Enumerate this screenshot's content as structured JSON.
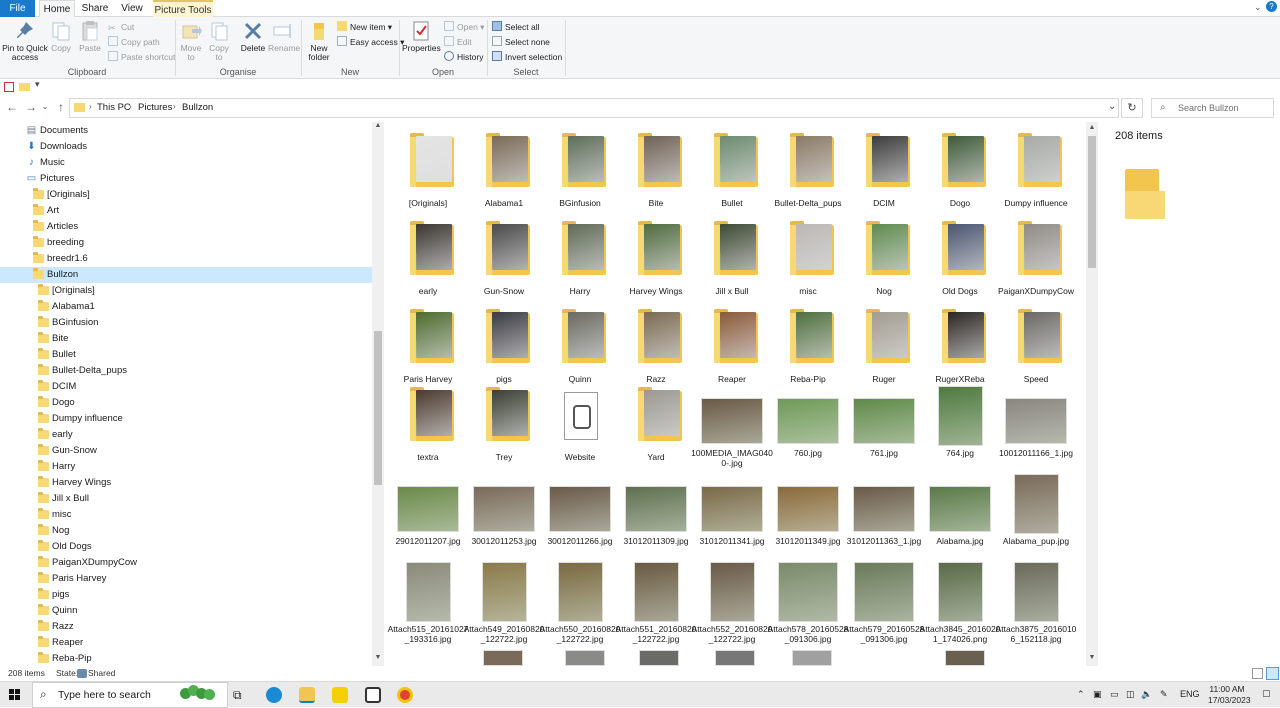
{
  "ribbon_tabs": [
    "File",
    "Home",
    "Share",
    "View",
    "Picture Tools"
  ],
  "ribbon": {
    "clipboard": {
      "pin_label": "Pin to Quick access",
      "copy_label": "Copy",
      "paste_label": "Paste",
      "cut_label": "Cut",
      "copy_path_label": "Copy path",
      "paste_shortcut_label": "Paste shortcut",
      "group_label": "Clipboard"
    },
    "organise": {
      "move_to_label": "Move to",
      "copy_to_label": "Copy to",
      "delete_label": "Delete",
      "rename_label": "Rename",
      "group_label": "Organise"
    },
    "new": {
      "new_folder_label": "New folder",
      "new_item_label": "New item",
      "easy_access_label": "Easy access",
      "group_label": "New"
    },
    "open": {
      "properties_label": "Properties",
      "open_label": "Open",
      "edit_label": "Edit",
      "history_label": "History",
      "group_label": "Open"
    },
    "select": {
      "select_all_label": "Select all",
      "select_none_label": "Select none",
      "invert_label": "Invert selection",
      "group_label": "Select"
    }
  },
  "breadcrumb": [
    "This PC",
    "Pictures",
    "Bullzon"
  ],
  "search_placeholder": "Search Bullzon",
  "nav_tree": [
    {
      "label": "Documents",
      "icon": "documents-icon",
      "level": 0
    },
    {
      "label": "Downloads",
      "icon": "downloads-icon",
      "level": 0
    },
    {
      "label": "Music",
      "icon": "music-icon",
      "level": 0
    },
    {
      "label": "Pictures",
      "icon": "pictures-icon",
      "level": 0
    },
    {
      "label": "[Originals]",
      "icon": "folder-icon",
      "level": 1
    },
    {
      "label": "Art",
      "icon": "folder-icon",
      "level": 1
    },
    {
      "label": "Articles",
      "icon": "folder-icon",
      "level": 1
    },
    {
      "label": "breeding",
      "icon": "folder-icon",
      "level": 1
    },
    {
      "label": "breedr1.6",
      "icon": "folder-icon",
      "level": 1
    },
    {
      "label": "Bullzon",
      "icon": "folder-icon",
      "level": 1,
      "selected": true
    },
    {
      "label": "[Originals]",
      "icon": "folder-icon",
      "level": 2
    },
    {
      "label": "Alabama1",
      "icon": "folder-icon",
      "level": 2
    },
    {
      "label": "BGinfusion",
      "icon": "folder-icon",
      "level": 2
    },
    {
      "label": "Bite",
      "icon": "folder-icon",
      "level": 2
    },
    {
      "label": "Bullet",
      "icon": "folder-icon",
      "level": 2
    },
    {
      "label": "Bullet-Delta_pups",
      "icon": "folder-icon",
      "level": 2
    },
    {
      "label": "DCIM",
      "icon": "folder-icon",
      "level": 2
    },
    {
      "label": "Dogo",
      "icon": "folder-icon",
      "level": 2
    },
    {
      "label": "Dumpy influence",
      "icon": "folder-icon",
      "level": 2
    },
    {
      "label": "early",
      "icon": "folder-icon",
      "level": 2
    },
    {
      "label": "Gun-Snow",
      "icon": "folder-icon",
      "level": 2
    },
    {
      "label": "Harry",
      "icon": "folder-icon",
      "level": 2
    },
    {
      "label": "Harvey Wings",
      "icon": "folder-icon",
      "level": 2
    },
    {
      "label": "Jill x Bull",
      "icon": "folder-icon",
      "level": 2
    },
    {
      "label": "misc",
      "icon": "folder-icon",
      "level": 2
    },
    {
      "label": "Nog",
      "icon": "folder-icon",
      "level": 2
    },
    {
      "label": "Old Dogs",
      "icon": "folder-icon",
      "level": 2
    },
    {
      "label": "PaiganXDumpyCow",
      "icon": "folder-icon",
      "level": 2
    },
    {
      "label": "Paris Harvey",
      "icon": "folder-icon",
      "level": 2
    },
    {
      "label": "pigs",
      "icon": "folder-icon",
      "level": 2
    },
    {
      "label": "Quinn",
      "icon": "folder-icon",
      "level": 2
    },
    {
      "label": "Razz",
      "icon": "folder-icon",
      "level": 2
    },
    {
      "label": "Reaper",
      "icon": "folder-icon",
      "level": 2
    },
    {
      "label": "Reba-Pip",
      "icon": "folder-icon",
      "level": 2
    }
  ],
  "files": [
    {
      "name": "[Originals]",
      "type": "folder",
      "color": "#e4e4e4"
    },
    {
      "name": "Alabama1",
      "type": "folder",
      "color": "#7a6a58"
    },
    {
      "name": "BGinfusion",
      "type": "folder",
      "color": "#5e6e5a"
    },
    {
      "name": "Bite",
      "type": "folder",
      "color": "#6f6255"
    },
    {
      "name": "Bullet",
      "type": "folder",
      "color": "#6c8a6e"
    },
    {
      "name": "Bullet-Delta_pups",
      "type": "folder",
      "color": "#8a7a66"
    },
    {
      "name": "DCIM",
      "type": "folder",
      "color": "#3c3c3c"
    },
    {
      "name": "Dogo",
      "type": "folder",
      "color": "#3e5a38"
    },
    {
      "name": "Dumpy influence",
      "type": "folder",
      "color": "#a7aaa6"
    },
    {
      "name": "early",
      "type": "folder",
      "color": "#3a3530"
    },
    {
      "name": "Gun-Snow",
      "type": "folder",
      "color": "#4a4a4a"
    },
    {
      "name": "Harry",
      "type": "folder",
      "color": "#5f6a55"
    },
    {
      "name": "Harvey Wings",
      "type": "folder",
      "color": "#4f6b3f"
    },
    {
      "name": "Jill x Bull",
      "type": "folder",
      "color": "#3e4a34"
    },
    {
      "name": "misc",
      "type": "folder",
      "color": "#bbb8b4"
    },
    {
      "name": "Nog",
      "type": "folder",
      "color": "#5f8a4f"
    },
    {
      "name": "Old Dogs",
      "type": "folder",
      "color": "#4a5570"
    },
    {
      "name": "PaiganXDumpyCow",
      "type": "folder",
      "color": "#8f8a85"
    },
    {
      "name": "Paris Harvey",
      "type": "folder",
      "color": "#4d6b2f"
    },
    {
      "name": "pigs",
      "type": "folder",
      "color": "#3a3a42"
    },
    {
      "name": "Quinn",
      "type": "folder",
      "color": "#6a6a62"
    },
    {
      "name": "Razz",
      "type": "folder",
      "color": "#7a6a52"
    },
    {
      "name": "Reaper",
      "type": "folder",
      "color": "#8a5a3a"
    },
    {
      "name": "Reba-Pip",
      "type": "folder",
      "color": "#4f6f3f"
    },
    {
      "name": "Ruger",
      "type": "folder",
      "color": "#a29c90"
    },
    {
      "name": "RugerXReba",
      "type": "folder",
      "color": "#2a2622"
    },
    {
      "name": "Speed",
      "type": "folder",
      "color": "#6a6864"
    },
    {
      "name": "textra",
      "type": "folder",
      "color": "#4a3a2e"
    },
    {
      "name": "Trey",
      "type": "folder",
      "color": "#3a3e32"
    },
    {
      "name": "Website",
      "type": "file",
      "color": "#ffffff"
    },
    {
      "name": "Yard",
      "type": "folder",
      "color": "#9a9890"
    },
    {
      "name": "100MEDIA_IMAG0400-.jpg",
      "type": "image",
      "color": "#6a5a46",
      "orient": "land"
    },
    {
      "name": "760.jpg",
      "type": "image",
      "color": "#6f9a58",
      "orient": "land"
    },
    {
      "name": "761.jpg",
      "type": "image",
      "color": "#5f8a4a",
      "orient": "land"
    },
    {
      "name": "764.jpg",
      "type": "image",
      "color": "#4f7a3f",
      "orient": "port"
    },
    {
      "name": "10012011166_1.jpg",
      "type": "image",
      "color": "#8a8680",
      "orient": "land"
    },
    {
      "name": "29012011207.jpg",
      "type": "image",
      "color": "#6a8a4a",
      "orient": "land"
    },
    {
      "name": "30012011253.jpg",
      "type": "image",
      "color": "#7a6a5a",
      "orient": "land"
    },
    {
      "name": "30012011266.jpg",
      "type": "image",
      "color": "#6a5a4a",
      "orient": "land"
    },
    {
      "name": "31012011309.jpg",
      "type": "image",
      "color": "#5f7050",
      "orient": "land"
    },
    {
      "name": "31012011341.jpg",
      "type": "image",
      "color": "#7a6a48",
      "orient": "land"
    },
    {
      "name": "31012011349.jpg",
      "type": "image",
      "color": "#8a6a3a",
      "orient": "land"
    },
    {
      "name": "31012011363_1.jpg",
      "type": "image",
      "color": "#6a5a48",
      "orient": "land"
    },
    {
      "name": "Alabama.jpg",
      "type": "image",
      "color": "#5a7a48",
      "orient": "land"
    },
    {
      "name": "Alabama_pup.jpg",
      "type": "image",
      "color": "#7a6a5a",
      "orient": "port"
    },
    {
      "name": "Attach515_20161027_193316.jpg",
      "type": "image",
      "color": "#8a8a7a",
      "orient": "port"
    },
    {
      "name": "Attach549_20160820_122722.jpg",
      "type": "image",
      "color": "#8a7a4a",
      "orient": "port"
    },
    {
      "name": "Attach550_20160820_122722.jpg",
      "type": "image",
      "color": "#7a6a42",
      "orient": "port"
    },
    {
      "name": "Attach551_20160820_122722.jpg",
      "type": "image",
      "color": "#6a5a42",
      "orient": "port"
    },
    {
      "name": "Attach552_20160820_122722.jpg",
      "type": "image",
      "color": "#6a5a48",
      "orient": "port"
    },
    {
      "name": "Attach578_20160528_091306.jpg",
      "type": "image",
      "color": "#7a8a6a",
      "orient": "square"
    },
    {
      "name": "Attach579_20160528_091306.jpg",
      "type": "image",
      "color": "#6a7a5a",
      "orient": "square"
    },
    {
      "name": "Attach3845_20160201_174026.png",
      "type": "image",
      "color": "#5a6a48",
      "orient": "port"
    },
    {
      "name": "Attach3875_20160106_152118.jpg",
      "type": "image",
      "color": "#6a6a5a",
      "orient": "port"
    }
  ],
  "partial_row_colors": [
    "#7a6a5a",
    "#8a8a88",
    "#6a6a66",
    "#777777",
    "#a0a0a0",
    "#6a6050"
  ],
  "preview": {
    "item_count": "208 items"
  },
  "status": {
    "item_count": "208 items",
    "state_label": "State:",
    "state_value": "Shared"
  },
  "taskbar": {
    "search_placeholder": "Type here to search",
    "language": "ENG",
    "time": "11:00 AM",
    "date": "17/03/2023"
  },
  "colors": {
    "accent": "#1979ca",
    "selection": "#cce8ff",
    "folder": "#f8d775"
  }
}
